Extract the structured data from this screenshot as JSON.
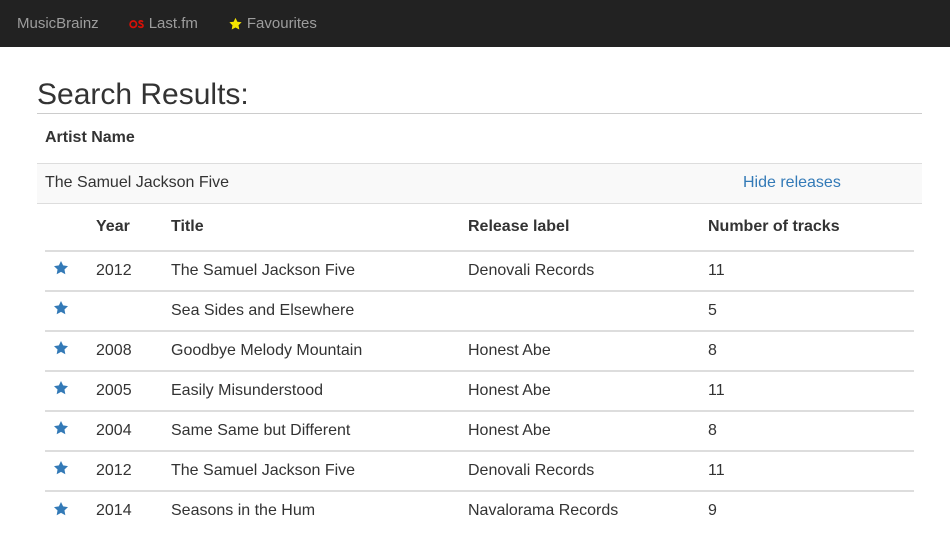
{
  "nav": {
    "brand": "MusicBrainz",
    "lastfm": "Last.fm",
    "favourites": "Favourites"
  },
  "page": {
    "title": "Search Results:"
  },
  "artists": {
    "header": "Artist Name",
    "rows": [
      {
        "name": "The Samuel Jackson Five",
        "toggle_label": "Hide releases"
      }
    ]
  },
  "releases": {
    "columns": {
      "year": "Year",
      "title": "Title",
      "label": "Release label",
      "tracks": "Number of tracks"
    },
    "rows": [
      {
        "year": "2012",
        "title": "The Samuel Jackson Five",
        "label": "Denovali Records",
        "tracks": "11"
      },
      {
        "year": "",
        "title": "Sea Sides and Elsewhere",
        "label": "",
        "tracks": "5"
      },
      {
        "year": "2008",
        "title": "Goodbye Melody Mountain",
        "label": "Honest Abe",
        "tracks": "8"
      },
      {
        "year": "2005",
        "title": "Easily Misunderstood",
        "label": "Honest Abe",
        "tracks": "11"
      },
      {
        "year": "2004",
        "title": "Same Same but Different",
        "label": "Honest Abe",
        "tracks": "8"
      },
      {
        "year": "2012",
        "title": "The Samuel Jackson Five",
        "label": "Denovali Records",
        "tracks": "11"
      },
      {
        "year": "2014",
        "title": "Seasons in the Hum",
        "label": "Navalorama Records",
        "tracks": "9"
      }
    ]
  },
  "icons": {
    "lastfm": "lastfm-logo-icon",
    "favourites": "star-icon",
    "row_favourite": "star-icon"
  },
  "colors": {
    "navbar_bg": "#222222",
    "nav_text": "#9d9d9d",
    "lastfm_red": "#d51007",
    "fav_star_yellow": "#f5e400",
    "link_blue": "#337ab7",
    "row_star_blue": "#337ab7"
  }
}
